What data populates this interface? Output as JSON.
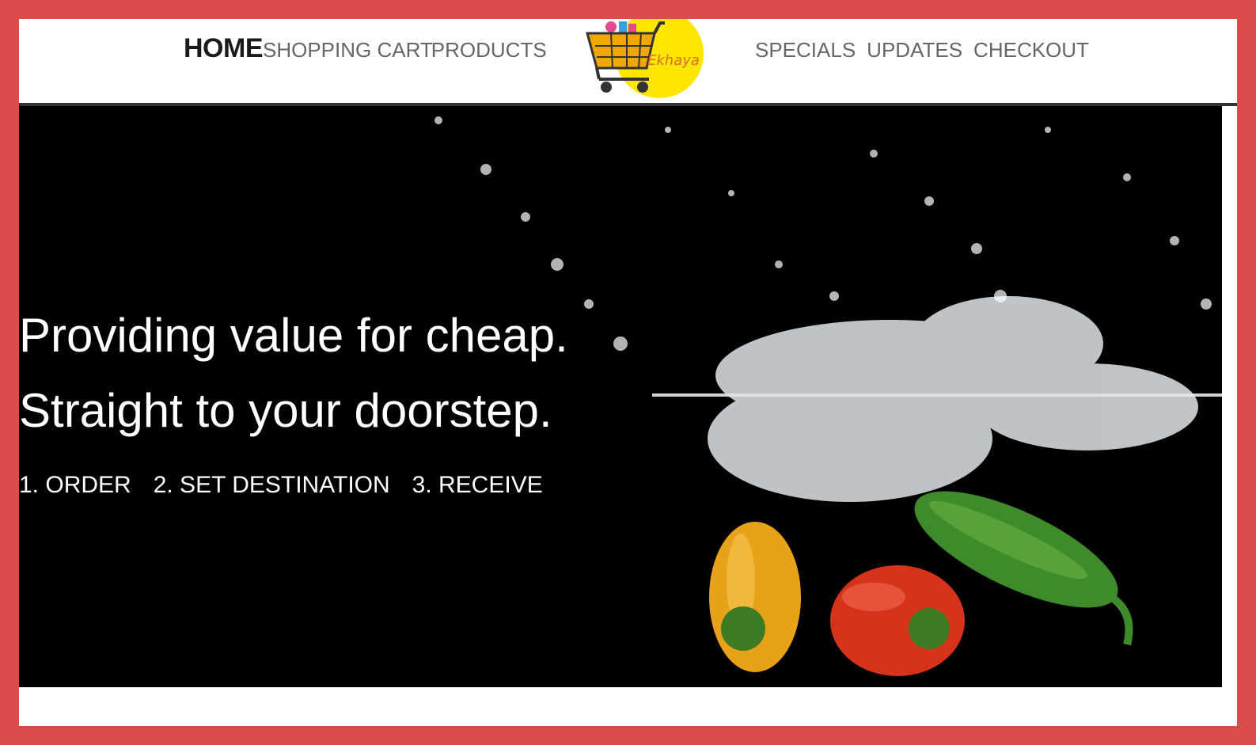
{
  "nav": {
    "left": [
      "HOME",
      "SHOPPING CART",
      "PRODUCTS"
    ],
    "right": [
      "SPECIALS",
      "UPDATES",
      "CHECKOUT"
    ]
  },
  "logo": {
    "name": "Ekhaya",
    "icon": "shopping-cart-icon"
  },
  "hero": {
    "line1": "Providing value for cheap.",
    "line2": "Straight to your doorstep.",
    "steps": [
      "1. ORDER",
      "2. SET DESTINATION",
      "3. RECEIVE"
    ],
    "image": "peppers-splashing-water"
  },
  "colors": {
    "border": "#d94c4c",
    "accent_yellow": "#ffe600",
    "hero_bg": "#000000",
    "nav_text": "#666666",
    "active_nav_text": "#1b1b1b"
  }
}
